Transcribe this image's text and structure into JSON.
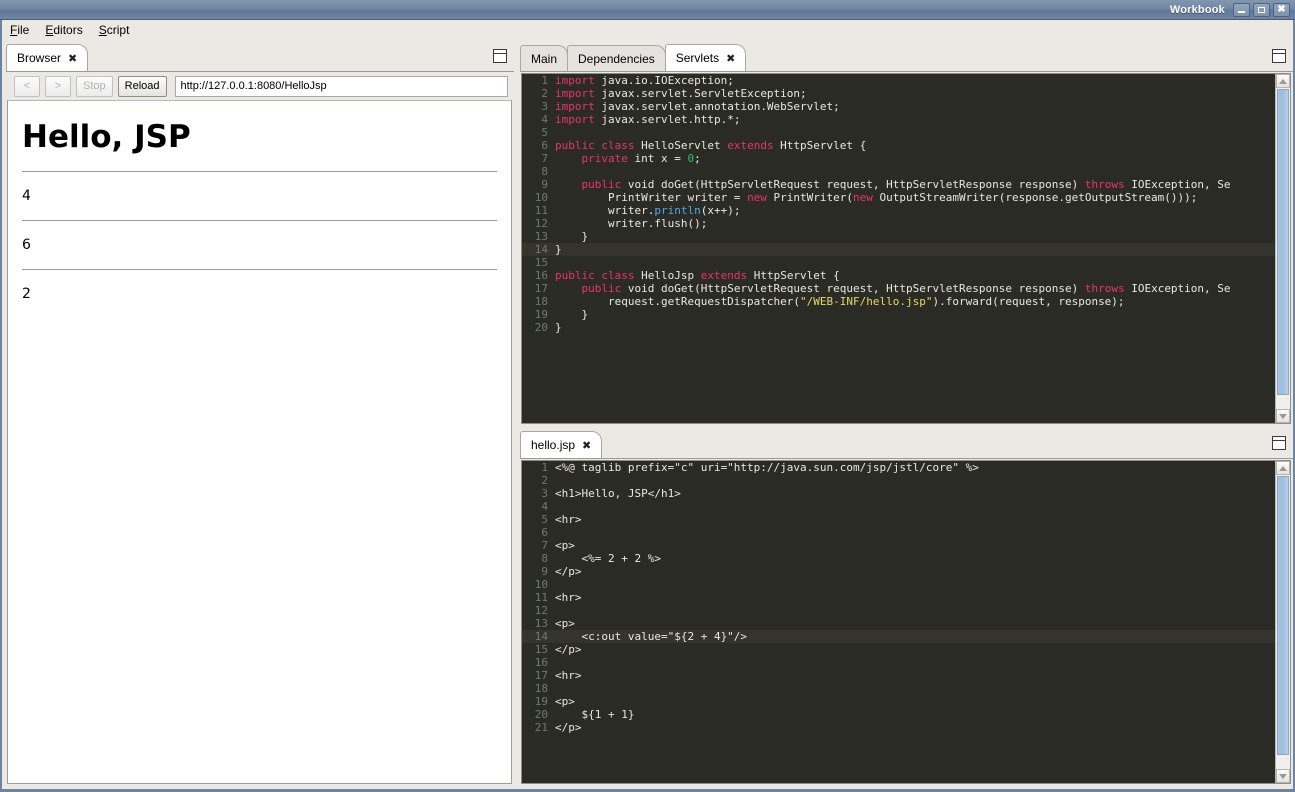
{
  "window": {
    "title": "Workbook",
    "buttons": {
      "minimize": "minimize-icon",
      "maximize": "maximize-icon",
      "close": "close-icon"
    }
  },
  "menubar": {
    "items": [
      {
        "label": "File",
        "mnemonic": "F"
      },
      {
        "label": "Editors",
        "mnemonic": "E"
      },
      {
        "label": "Script",
        "mnemonic": "S"
      }
    ]
  },
  "browser_panel": {
    "tab": {
      "label": "Browser",
      "close": "✖"
    },
    "maximize": "maximize-icon",
    "toolbar": {
      "back": "<",
      "forward": ">",
      "stop": "Stop",
      "reload": "Reload",
      "url_value": "http://127.0.0.1:8080/HelloJsp",
      "url_placeholder": "http://127.0.0.1:8080/HelloJsp"
    },
    "page": {
      "heading": "Hello, JSP",
      "values": [
        "4",
        "6",
        "2"
      ]
    }
  },
  "editor_panel": {
    "tabs": [
      {
        "label": "Main",
        "active": false
      },
      {
        "label": "Dependencies",
        "active": false
      },
      {
        "label": "Servlets",
        "active": true,
        "close": "✖"
      }
    ],
    "maximize": "maximize-icon",
    "current_line": 14,
    "lines": [
      {
        "n": "1",
        "tokens": [
          {
            "t": "import",
            "c": "kw"
          },
          {
            "t": " java.io.IOException;",
            "c": "src"
          }
        ]
      },
      {
        "n": "2",
        "tokens": [
          {
            "t": "import",
            "c": "kw"
          },
          {
            "t": " javax.servlet.ServletException;",
            "c": "src"
          }
        ]
      },
      {
        "n": "3",
        "tokens": [
          {
            "t": "import",
            "c": "kw"
          },
          {
            "t": " javax.servlet.annotation.WebServlet;",
            "c": "src"
          }
        ]
      },
      {
        "n": "4",
        "tokens": [
          {
            "t": "import",
            "c": "kw"
          },
          {
            "t": " javax.servlet.http.*;",
            "c": "src"
          }
        ]
      },
      {
        "n": "5",
        "tokens": []
      },
      {
        "n": "6",
        "tokens": [
          {
            "t": "public class",
            "c": "kw"
          },
          {
            "t": " HelloServlet ",
            "c": "src"
          },
          {
            "t": "extends",
            "c": "kw"
          },
          {
            "t": " HttpServlet {",
            "c": "src"
          }
        ]
      },
      {
        "n": "7",
        "tokens": [
          {
            "t": "    private",
            "c": "kw"
          },
          {
            "t": " int x = ",
            "c": "src"
          },
          {
            "t": "0",
            "c": "num"
          },
          {
            "t": ";",
            "c": "src"
          }
        ]
      },
      {
        "n": "8",
        "tokens": []
      },
      {
        "n": "9",
        "tokens": [
          {
            "t": "    public",
            "c": "kw"
          },
          {
            "t": " void doGet(HttpServletRequest request, HttpServletResponse response) ",
            "c": "src"
          },
          {
            "t": "throws",
            "c": "kw"
          },
          {
            "t": " IOException, Se",
            "c": "src"
          }
        ]
      },
      {
        "n": "10",
        "tokens": [
          {
            "t": "        PrintWriter writer = ",
            "c": "src"
          },
          {
            "t": "new",
            "c": "kw"
          },
          {
            "t": " PrintWriter(",
            "c": "src"
          },
          {
            "t": "new",
            "c": "kw"
          },
          {
            "t": " OutputStreamWriter(response.getOutputStream()));",
            "c": "src"
          }
        ]
      },
      {
        "n": "11",
        "tokens": [
          {
            "t": "        writer.",
            "c": "src"
          },
          {
            "t": "println",
            "c": "fn"
          },
          {
            "t": "(x++);",
            "c": "src"
          }
        ]
      },
      {
        "n": "12",
        "tokens": [
          {
            "t": "        writer.flush();",
            "c": "src"
          }
        ]
      },
      {
        "n": "13",
        "tokens": [
          {
            "t": "    }",
            "c": "src"
          }
        ]
      },
      {
        "n": "14",
        "tokens": [
          {
            "t": "}",
            "c": "src"
          }
        ]
      },
      {
        "n": "15",
        "tokens": []
      },
      {
        "n": "16",
        "tokens": [
          {
            "t": "public class",
            "c": "kw"
          },
          {
            "t": " HelloJsp ",
            "c": "src"
          },
          {
            "t": "extends",
            "c": "kw"
          },
          {
            "t": " HttpServlet {",
            "c": "src"
          }
        ]
      },
      {
        "n": "17",
        "tokens": [
          {
            "t": "    public",
            "c": "kw"
          },
          {
            "t": " void doGet(HttpServletRequest request, HttpServletResponse response) ",
            "c": "src"
          },
          {
            "t": "throws",
            "c": "kw"
          },
          {
            "t": " IOException, Se",
            "c": "src"
          }
        ]
      },
      {
        "n": "18",
        "tokens": [
          {
            "t": "        request.getRequestDispatcher(",
            "c": "src"
          },
          {
            "t": "\"/WEB-INF/hello.jsp\"",
            "c": "str"
          },
          {
            "t": ").forward(request, response);",
            "c": "src"
          }
        ]
      },
      {
        "n": "19",
        "tokens": [
          {
            "t": "    }",
            "c": "src"
          }
        ]
      },
      {
        "n": "20",
        "tokens": [
          {
            "t": "}",
            "c": "src"
          }
        ]
      }
    ]
  },
  "jsp_panel": {
    "tab": {
      "label": "hello.jsp",
      "close": "✖"
    },
    "maximize": "maximize-icon",
    "current_line": 14,
    "lines": [
      {
        "n": "1",
        "tokens": [
          {
            "t": "<%@ taglib prefix=\"c\" uri=\"http://java.sun.com/jsp/jstl/core\" %>",
            "c": "src"
          }
        ]
      },
      {
        "n": "2",
        "tokens": []
      },
      {
        "n": "3",
        "tokens": [
          {
            "t": "<h1>Hello, JSP</h1>",
            "c": "src"
          }
        ]
      },
      {
        "n": "4",
        "tokens": []
      },
      {
        "n": "5",
        "tokens": [
          {
            "t": "<hr>",
            "c": "src"
          }
        ]
      },
      {
        "n": "6",
        "tokens": []
      },
      {
        "n": "7",
        "tokens": [
          {
            "t": "<p>",
            "c": "src"
          }
        ]
      },
      {
        "n": "8",
        "tokens": [
          {
            "t": "    <%= 2 + 2 %>",
            "c": "src"
          }
        ]
      },
      {
        "n": "9",
        "tokens": [
          {
            "t": "</p>",
            "c": "src"
          }
        ]
      },
      {
        "n": "10",
        "tokens": []
      },
      {
        "n": "11",
        "tokens": [
          {
            "t": "<hr>",
            "c": "src"
          }
        ]
      },
      {
        "n": "12",
        "tokens": []
      },
      {
        "n": "13",
        "tokens": [
          {
            "t": "<p>",
            "c": "src"
          }
        ]
      },
      {
        "n": "14",
        "tokens": [
          {
            "t": "    <c:out value=\"${2 + 4}\"/>",
            "c": "src"
          }
        ]
      },
      {
        "n": "15",
        "tokens": [
          {
            "t": "</p>",
            "c": "src"
          }
        ]
      },
      {
        "n": "16",
        "tokens": []
      },
      {
        "n": "17",
        "tokens": [
          {
            "t": "<hr>",
            "c": "src"
          }
        ]
      },
      {
        "n": "18",
        "tokens": []
      },
      {
        "n": "19",
        "tokens": [
          {
            "t": "<p>",
            "c": "src"
          }
        ]
      },
      {
        "n": "20",
        "tokens": [
          {
            "t": "    ${1 + 1}",
            "c": "src"
          }
        ]
      },
      {
        "n": "21",
        "tokens": [
          {
            "t": "</p>",
            "c": "src"
          }
        ]
      }
    ]
  },
  "colors": {
    "editor_bg": "#2b2b25",
    "keyword": "#e8336d",
    "string": "#e4d96a",
    "number": "#2fbf5e",
    "function": "#4aa8e8",
    "text": "#e8e8e0",
    "line_number": "#6f7a6f",
    "titlebar": "#6e85a1",
    "scroll_thumb": "#a9c3e0"
  }
}
